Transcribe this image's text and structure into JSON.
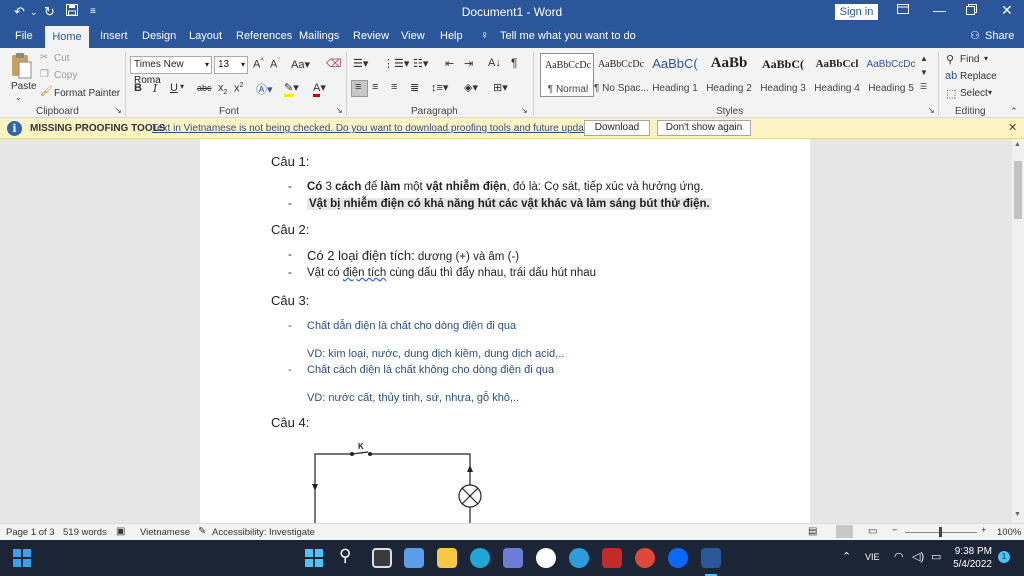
{
  "titlebar": {
    "title": "Document1 - Word",
    "signin": "Sign in",
    "undo_icon": "undo-icon",
    "redo_icon": "redo-icon",
    "save_icon": "save-icon"
  },
  "tabs": [
    "File",
    "Home",
    "Insert",
    "Design",
    "Layout",
    "References",
    "Mailings",
    "Review",
    "View",
    "Help"
  ],
  "tell_me": "Tell me what you want to do",
  "share": "Share",
  "ribbon": {
    "clipboard": {
      "paste": "Paste",
      "cut": "Cut",
      "copy": "Copy",
      "format_painter": "Format Painter",
      "label": "Clipboard"
    },
    "font": {
      "name": "Times New Roma",
      "size": "13",
      "label": "Font"
    },
    "paragraph": {
      "label": "Paragraph"
    },
    "styles": {
      "label": "Styles",
      "items": [
        {
          "preview": "AaBbCcDc",
          "name": "¶ Normal"
        },
        {
          "preview": "AaBbCcDc",
          "name": "¶ No Spac..."
        },
        {
          "preview": "AaBbC(",
          "name": "Heading 1"
        },
        {
          "preview": "AaBb",
          "name": "Heading 2"
        },
        {
          "preview": "AaBbC(",
          "name": "Heading 3"
        },
        {
          "preview": "AaBbCcl",
          "name": "Heading 4"
        },
        {
          "preview": "AaBbCcDc",
          "name": "Heading 5"
        }
      ]
    },
    "editing": {
      "find": "Find",
      "replace": "Replace",
      "select": "Select",
      "label": "Editing"
    }
  },
  "msgbar": {
    "title": "MISSING PROOFING TOOLS",
    "text": "Text in Vietnamese is not being checked. Do you want to download proofing tools and future updates?",
    "download": "Download",
    "dont_show": "Don't show again"
  },
  "document": {
    "q1": {
      "heading": "Câu 1:",
      "b1": {
        "a": "Có",
        "b": " 3 ",
        "c": "cách",
        "d": " để ",
        "e": "làm",
        "f": " một ",
        "g": "vật nhiễm điện",
        "h": ", đó là: Cọ sát, tiếp xúc và hưởng ứng."
      },
      "b2": "Vật bị nhiễm điện có khả năng hút các vật khác và làm sáng bút thử điện."
    },
    "q2": {
      "heading": "Câu 2:",
      "b1a": "Có 2 loại điện tích:",
      "b1b": " dương (+) và âm (-)",
      "b2a": "Vật có ",
      "b2b": "điện  tích",
      "b2c": " cùng dấu thì đẩy nhau, trái dấu hút nhau"
    },
    "q3": {
      "heading": "Câu 3:",
      "b1": "Chất dẫn điện là chất cho dòng điện đi qua",
      "ex1": "VD: kim loại, nước, dung dịch kiềm, dung dịch acid,..",
      "b2": "Chất cách điện là chất không cho dòng điện đi qua",
      "ex2": "VD: nước cất, thủy tinh, sứ, nhựa, gỗ khô,.."
    },
    "q4": {
      "heading": "Câu 4:",
      "switch_label": "K"
    },
    "dash": "-"
  },
  "status": {
    "page": "Page 1 of 3",
    "words": "519 words",
    "language": "Vietnamese",
    "accessibility": "Accessibility: Investigate",
    "zoom": "100%"
  },
  "taskbar": {
    "lang": "VIE",
    "time": "9:38 PM",
    "date": "5/4/2022",
    "notif": "1"
  },
  "colors": {
    "word_blue": "#2b579a",
    "taskbar": "#1c2536",
    "msgbar": "#fcf3c4"
  }
}
